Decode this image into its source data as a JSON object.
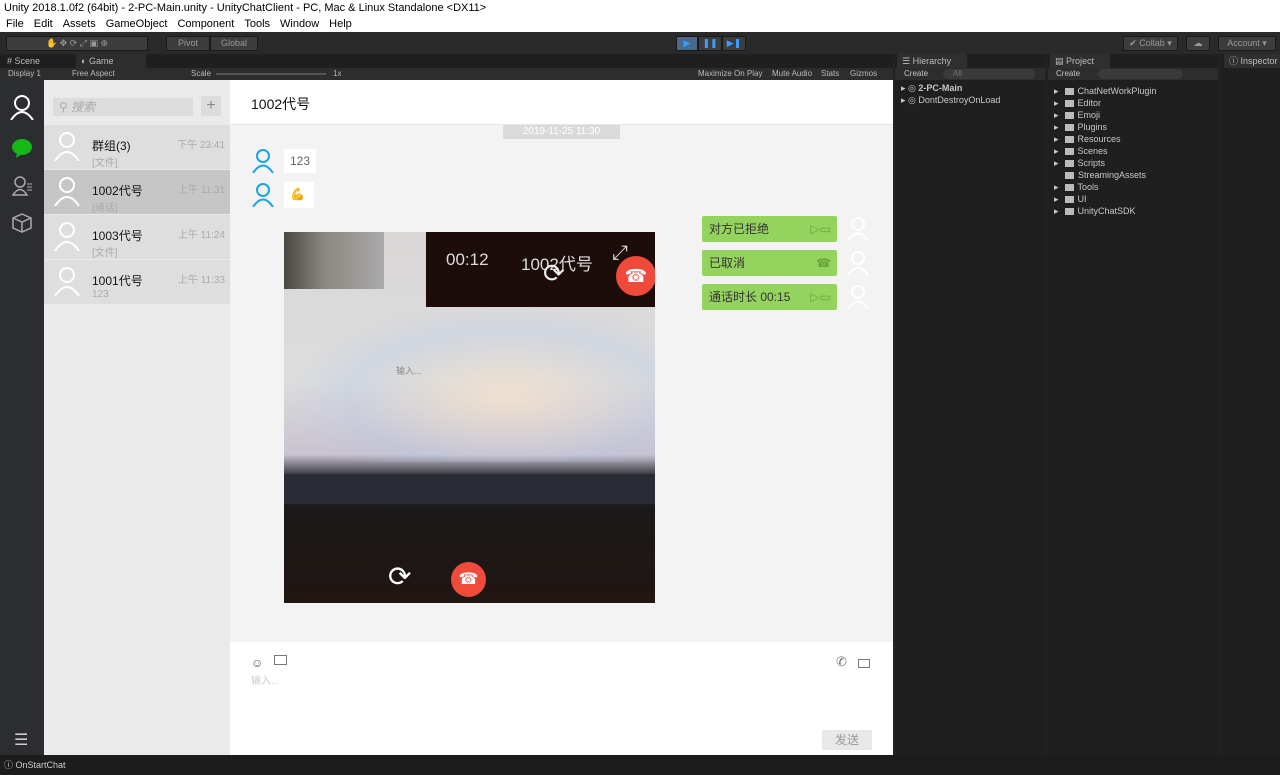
{
  "window": {
    "title": "Unity 2018.1.0f2 (64bit) - 2-PC-Main.unity - UnityChatClient - PC, Mac & Linux Standalone <DX11>"
  },
  "menu": [
    "File",
    "Edit",
    "Assets",
    "GameObject",
    "Component",
    "Tools",
    "Window",
    "Help"
  ],
  "toolbar": {
    "pivot": "Pivot",
    "global": "Global",
    "collab": "Collab",
    "account": "Account"
  },
  "tabs": {
    "scene": "Scene",
    "game": "Game",
    "hierarchy": "Hierarchy",
    "project": "Project",
    "inspector": "Inspector"
  },
  "gamebar": {
    "display": "Display 1",
    "aspect": "Free Aspect",
    "scale": "Scale",
    "scale_value": "1x",
    "maximize": "Maximize On Play",
    "mute": "Mute Audio",
    "stats": "Stats",
    "gizmos": "Gizmos"
  },
  "app": {
    "search_placeholder": "搜索",
    "add": "+",
    "conversations": [
      {
        "name": "群组(3)",
        "sub": "[文件]",
        "time": "下午 23:41"
      },
      {
        "name": "1002代号",
        "sub": "[通话]",
        "time": "上午 11:31"
      },
      {
        "name": "1003代号",
        "sub": "[文件]",
        "time": "上午 11:24"
      },
      {
        "name": "1001代号",
        "sub": "123",
        "time": "上午 11:33"
      }
    ],
    "chat_title": "1002代号",
    "timestamp": "2019-11-25 11:30",
    "messages_in": [
      "123"
    ],
    "call_messages": [
      "对方已拒绝",
      "已取消",
      "通话时长 00:15"
    ],
    "video": {
      "duration": "00:12",
      "peer": "1002代号",
      "overlay_text": "输入..."
    },
    "input_placeholder": "输入...",
    "send": "发送",
    "accent": "#95d35f"
  },
  "hierarchy": {
    "create": "Create",
    "search": "All",
    "items": [
      "2-PC-Main",
      "DontDestroyOnLoad"
    ]
  },
  "project": {
    "create": "Create",
    "folders": [
      "ChatNetWorkPlugin",
      "Editor",
      "Emoji",
      "Plugins",
      "Resources",
      "Scenes",
      "Scripts",
      "StreamingAssets",
      "Tools",
      "UI",
      "UnityChatSDK"
    ]
  },
  "status": "OnStartChat"
}
